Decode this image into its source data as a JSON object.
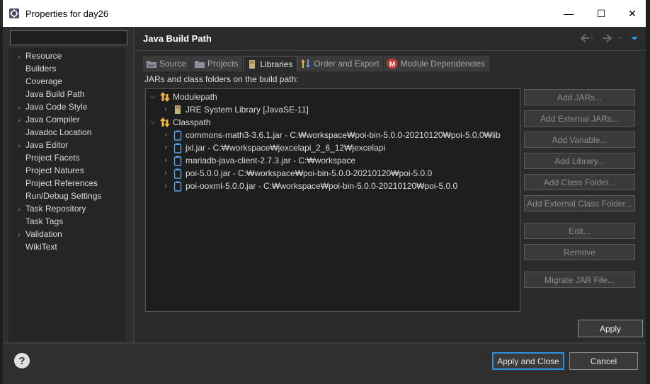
{
  "window": {
    "title": "Properties for day26",
    "min_glyph": "—",
    "max_glyph": "☐",
    "close_glyph": "✕"
  },
  "filter": {
    "value": "",
    "placeholder": ""
  },
  "nav": {
    "items": [
      {
        "label": "Resource",
        "expandable": true
      },
      {
        "label": "Builders",
        "expandable": false
      },
      {
        "label": "Coverage",
        "expandable": false
      },
      {
        "label": "Java Build Path",
        "expandable": false
      },
      {
        "label": "Java Code Style",
        "expandable": true
      },
      {
        "label": "Java Compiler",
        "expandable": true
      },
      {
        "label": "Javadoc Location",
        "expandable": false
      },
      {
        "label": "Java Editor",
        "expandable": true
      },
      {
        "label": "Project Facets",
        "expandable": false
      },
      {
        "label": "Project Natures",
        "expandable": false
      },
      {
        "label": "Project References",
        "expandable": false
      },
      {
        "label": "Run/Debug Settings",
        "expandable": false
      },
      {
        "label": "Task Repository",
        "expandable": true
      },
      {
        "label": "Task Tags",
        "expandable": false
      },
      {
        "label": "Validation",
        "expandable": true
      },
      {
        "label": "WikiText",
        "expandable": false
      }
    ]
  },
  "page": {
    "title": "Java Build Path",
    "tabs": [
      {
        "label": "Source",
        "icon": "source-folder-icon",
        "active": false
      },
      {
        "label": "Projects",
        "icon": "projects-folder-icon",
        "active": false
      },
      {
        "label": "Libraries",
        "icon": "library-icon",
        "active": true
      },
      {
        "label": "Order and Export",
        "icon": "order-export-icon",
        "active": false
      },
      {
        "label": "Module Dependencies",
        "icon": "module-icon",
        "active": false
      }
    ],
    "path_label": "JARs and class folders on the build path:",
    "tree": {
      "modulepath": {
        "label": "Modulepath",
        "children": [
          {
            "label": "JRE System Library [JavaSE-11]"
          }
        ]
      },
      "classpath": {
        "label": "Classpath",
        "children": [
          {
            "label": "commons-math3-3.6.1.jar - C:₩workspace₩poi-bin-5.0.0-20210120₩poi-5.0.0₩lib"
          },
          {
            "label": "jxl.jar - C:₩workspace₩jexcelapi_2_6_12₩jexcelapi"
          },
          {
            "label": "mariadb-java-client-2.7.3.jar - C:₩workspace"
          },
          {
            "label": "poi-5.0.0.jar - C:₩workspace₩poi-bin-5.0.0-20210120₩poi-5.0.0"
          },
          {
            "label": "poi-ooxml-5.0.0.jar - C:₩workspace₩poi-bin-5.0.0-20210120₩poi-5.0.0"
          }
        ]
      }
    },
    "buttons": {
      "add_jars": "Add JARs...",
      "add_external_jars": "Add External JARs...",
      "add_variable": "Add Variable...",
      "add_library": "Add Library...",
      "add_class_folder": "Add Class Folder...",
      "add_external_class_folder": "Add External Class Folder...",
      "edit": "Edit...",
      "remove": "Remove",
      "migrate_jar": "Migrate JAR File...",
      "apply": "Apply"
    }
  },
  "footer": {
    "help_glyph": "?",
    "apply_and_close": "Apply and Close",
    "cancel": "Cancel"
  },
  "colors": {
    "background": "#2f2f2f",
    "tree_background": "#1e1e1e",
    "default_button_border": "#2f8fd8",
    "jar_icon": "#5aa0e6",
    "folder_arrow": "#f2b33d",
    "module_badge": "#c93a3a"
  }
}
